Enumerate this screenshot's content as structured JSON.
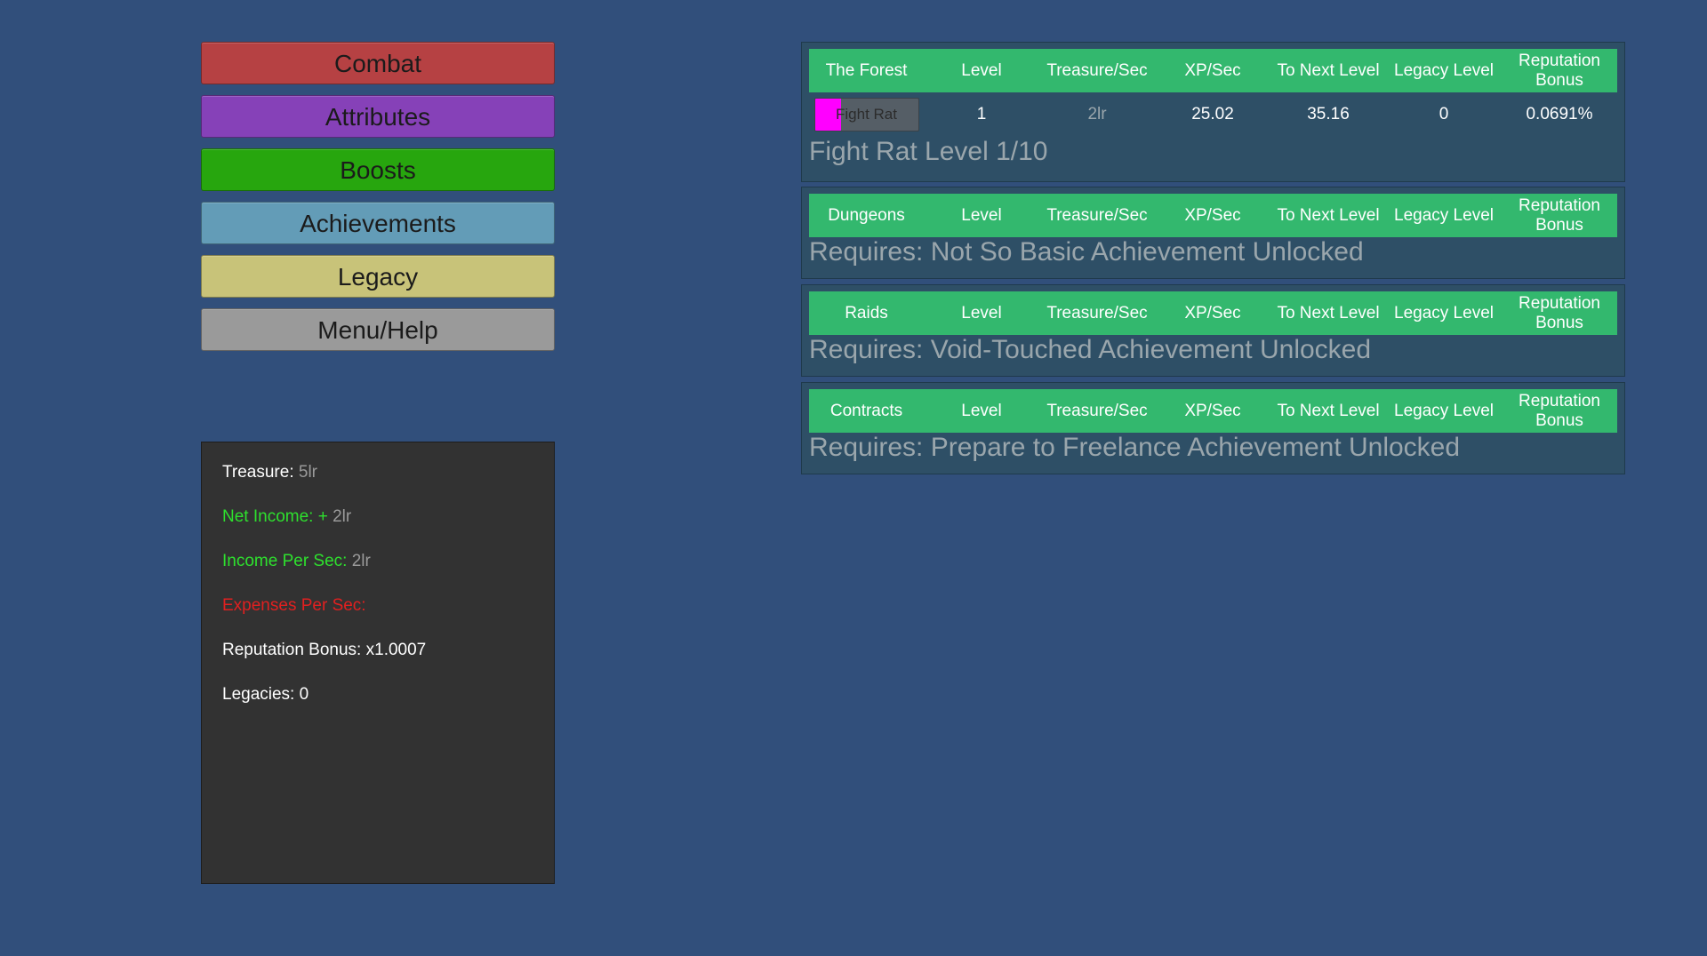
{
  "nav": {
    "items": [
      {
        "label": "Combat",
        "color": "#b64143"
      },
      {
        "label": "Attributes",
        "color": "#8641b8"
      },
      {
        "label": "Boosts",
        "color": "#27a60e"
      },
      {
        "label": "Achievements",
        "color": "#639cb7"
      },
      {
        "label": "Legacy",
        "color": "#c8c379"
      },
      {
        "label": "Menu/Help",
        "color": "#9a9a9a"
      }
    ]
  },
  "stats": {
    "treasure_label": "Treasure:",
    "treasure_value": "5lr",
    "net_income_label": "Net Income: +",
    "net_income_value": "2lr",
    "income_label": "Income Per Sec:",
    "income_value": "2lr",
    "expenses_label": "Expenses Per Sec:",
    "expenses_value": "",
    "reputation_label": "Reputation Bonus:",
    "reputation_value": "x1.0007",
    "legacies_label": "Legacies:",
    "legacies_value": "0"
  },
  "columns": {
    "level": "Level",
    "treasure_sec": "Treasure/Sec",
    "xp_sec": "XP/Sec",
    "to_next": "To Next Level",
    "legacy": "Legacy Level",
    "reputation": "Reputation Bonus"
  },
  "panels": {
    "forest": {
      "name": "The Forest",
      "task": {
        "label": "Fight Rat",
        "progress": 0.25,
        "level": "1",
        "treasure_sec": "2lr",
        "xp_sec": "25.02",
        "to_next": "35.16",
        "legacy": "0",
        "reputation": "0.0691%"
      },
      "status": "Fight Rat Level 1/10"
    },
    "dungeons": {
      "name": "Dungeons",
      "status": "Requires: Not So Basic Achievement Unlocked"
    },
    "raids": {
      "name": "Raids",
      "status": "Requires: Void-Touched Achievement Unlocked"
    },
    "contracts": {
      "name": "Contracts",
      "status": "Requires: Prepare to Freelance Achievement Unlocked"
    }
  }
}
